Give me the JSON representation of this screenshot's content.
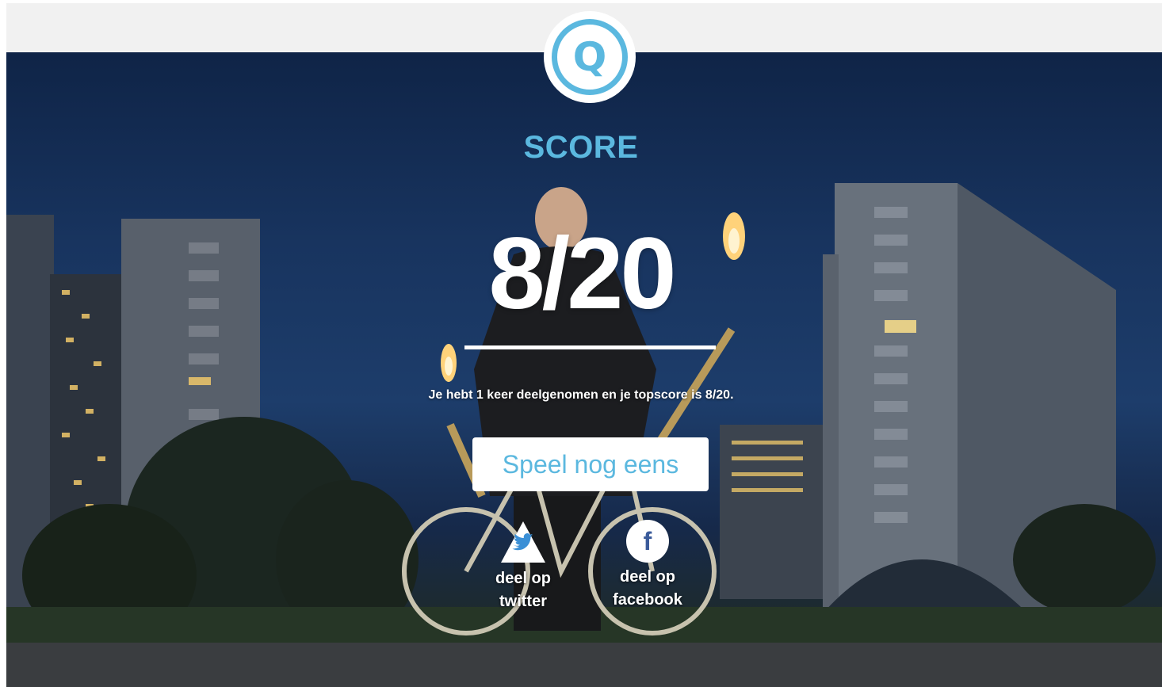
{
  "header": {
    "logo_letter": "Q"
  },
  "score": {
    "label": "SCORE",
    "value": "8/20",
    "summary": "Je hebt 1 keer deelgenomen en je topscore is 8/20."
  },
  "actions": {
    "replay_label": "Speel nog eens"
  },
  "share": {
    "twitter": {
      "line1": "deel op",
      "line2": "twitter",
      "icon": "twitter-icon"
    },
    "facebook": {
      "line1": "deel op",
      "line2": "facebook",
      "icon": "facebook-icon",
      "glyph": "f"
    }
  },
  "colors": {
    "accent": "#5bb8df",
    "topbar": "#f1f1f1",
    "twitter": "#3a8fd6",
    "facebook": "#3b5b9a"
  }
}
